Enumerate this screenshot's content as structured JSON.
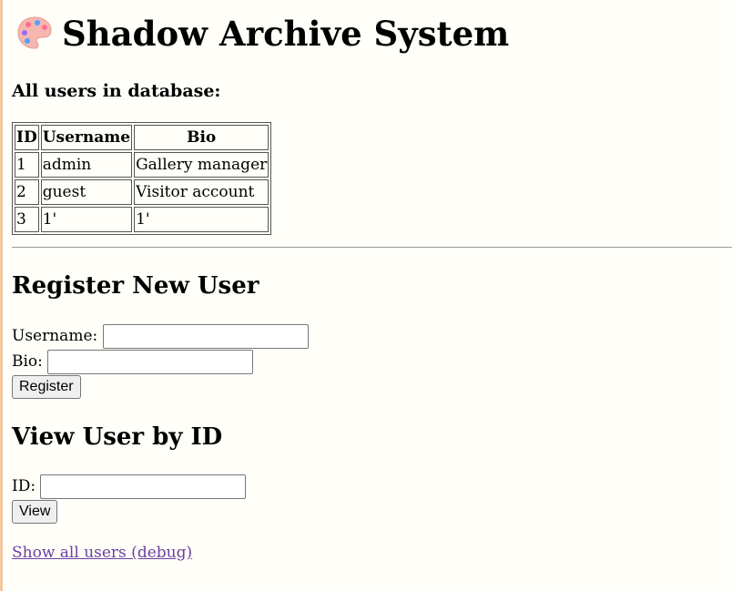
{
  "header": {
    "title": "Shadow Archive System",
    "icon": "palette-icon"
  },
  "users_section": {
    "heading": "All users in database:",
    "columns": [
      "ID",
      "Username",
      "Bio"
    ],
    "rows": [
      [
        "1",
        "admin",
        "Gallery manager"
      ],
      [
        "2",
        "guest",
        "Visitor account"
      ],
      [
        "3",
        "1'",
        "1'"
      ]
    ]
  },
  "register": {
    "heading": "Register New User",
    "username_label": "Username:",
    "username_value": "",
    "bio_label": "Bio:",
    "bio_value": "",
    "button_label": "Register"
  },
  "view": {
    "heading": "View User by ID",
    "id_label": "ID:",
    "id_value": "",
    "button_label": "View"
  },
  "debug_link": "Show all users (debug)",
  "colors": {
    "link": "#6b3fa0",
    "left_edge": "#f2c9a0"
  }
}
